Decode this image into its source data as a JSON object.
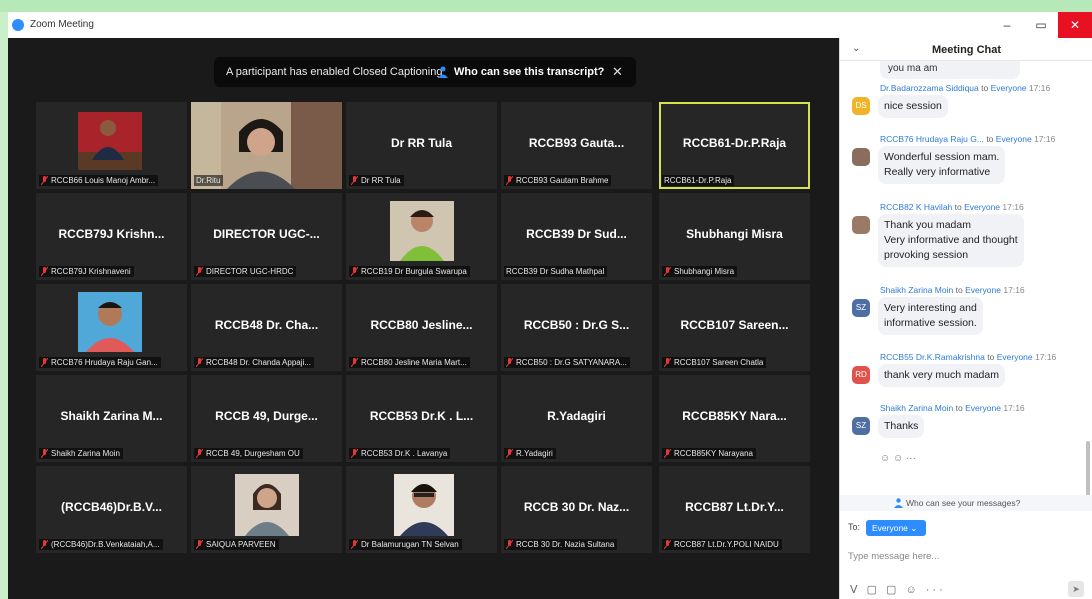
{
  "window": {
    "title": "Zoom Meeting",
    "minimize": "–",
    "restore": "▭",
    "close": "✕"
  },
  "banner": {
    "text": "A participant has enabled Closed Captioning",
    "link": "Who can see this transcript?",
    "close": "✕"
  },
  "tiles": [
    {
      "name": "",
      "label": "RCCB66 Louis Manoj Ambr..."
    },
    {
      "name": "",
      "label": "Dr.Ritu"
    },
    {
      "name": "Dr RR Tula",
      "label": "Dr RR Tula"
    },
    {
      "name": "RCCB93  Gauta...",
      "label": "RCCB93  Gautam Brahme"
    },
    {
      "name": "RCCB61-Dr.P.Raja",
      "label": "RCCB61-Dr.P.Raja"
    },
    {
      "name": "RCCB79J  Krishn...",
      "label": "RCCB79J Krishnaveni"
    },
    {
      "name": "DIRECTOR  UGC-...",
      "label": "DIRECTOR UGC-HRDC"
    },
    {
      "name": "",
      "label": "RCCB19 Dr Burgula Swarupa"
    },
    {
      "name": "RCCB39  Dr  Sud...",
      "label": "RCCB39 Dr Sudha Mathpal"
    },
    {
      "name": "Shubhangi Misra",
      "label": "Shubhangi Misra"
    },
    {
      "name": "",
      "label": "RCCB76 Hrudaya Raju Gan..."
    },
    {
      "name": "RCCB48  Dr. Cha...",
      "label": "RCCB48 Dr. Chanda Appaji..."
    },
    {
      "name": "RCCB80  Jesline...",
      "label": "RCCB80 Jesline Maria Mart..."
    },
    {
      "name": "RCCB50 : Dr.G S...",
      "label": "RCCB50 : Dr.G SATYANARA..."
    },
    {
      "name": "RCCB107  Sareen...",
      "label": "RCCB107 Sareen Chatla"
    },
    {
      "name": "Shaikh  Zarina  M...",
      "label": "Shaikh Zarina Moin"
    },
    {
      "name": "RCCB 49,  Durge...",
      "label": "RCCB 49, Durgesham OU"
    },
    {
      "name": "RCCB53  Dr.K . L...",
      "label": "RCCB53 Dr.K . Lavanya"
    },
    {
      "name": "R.Yadagiri",
      "label": "R.Yadagiri"
    },
    {
      "name": "RCCB85KY  Nara...",
      "label": "RCCB85KY Narayana"
    },
    {
      "name": "(RCCB46)Dr.B.V...",
      "label": "(RCCB46)Dr.B.Venkataiah,A..."
    },
    {
      "name": "",
      "label": "SAIQUA PARVEEN"
    },
    {
      "name": "",
      "label": "Dr Balamurugan TN Selvan"
    },
    {
      "name": "RCCB 30  Dr.  Naz...",
      "label": "RCCB 30 Dr. Nazia Sultana"
    },
    {
      "name": "RCCB87  Lt.Dr.Y...",
      "label": "RCCB87 Lt.Dr.Y.POLI NAIDU"
    }
  ],
  "chat": {
    "title": "Meeting Chat",
    "collapse": "⌄",
    "top_fragment": "you ma am",
    "messages": [
      {
        "avatar": "DS",
        "avatar_color": "#f0b429",
        "sender": "Dr.Badarozzama Siddiqua",
        "to": "to",
        "recipient": "Everyone",
        "time": "17:16",
        "lines": [
          "nice session"
        ]
      },
      {
        "avatar": "",
        "avatar_color": "#8a6d5c",
        "sender": "RCCB76 Hrudaya Raju G...",
        "to": "to",
        "recipient": "Everyone",
        "time": "17:16",
        "lines": [
          "Wonderful session mam.",
          "Really very informative"
        ]
      },
      {
        "avatar": "",
        "avatar_color": "#9a7a66",
        "sender": "RCCB82 K Havilah",
        "to": "to",
        "recipient": "Everyone",
        "time": "17:16",
        "lines": [
          "Thank you madam",
          "Very informative and thought",
          "provoking session"
        ]
      },
      {
        "avatar": "SZ",
        "avatar_color": "#4f6fa3",
        "sender": "Shaikh Zarina Moin",
        "to": "to",
        "recipient": "Everyone",
        "time": "17:16",
        "lines": [
          "Very interesting and",
          "informative  session."
        ]
      },
      {
        "avatar": "RD",
        "avatar_color": "#e0524b",
        "sender": "RCCB55 Dr.K.Ramakrishna",
        "to": "to",
        "recipient": "Everyone",
        "time": "17:16",
        "lines": [
          "thank very much madam"
        ]
      },
      {
        "avatar": "SZ",
        "avatar_color": "#4f6fa3",
        "sender": "Shaikh Zarina Moin",
        "to": "to",
        "recipient": "Everyone",
        "time": "17:16",
        "lines": [
          "Thanks"
        ]
      }
    ],
    "reactions": "☺ ☺ ···",
    "who_can_see": "Who can see your messages?",
    "to_label": "To:",
    "recipient_select": "Everyone ⌄",
    "input_placeholder": "Type message here...",
    "toolbar": "ᐯ ▢ ▢ ☺ ···",
    "send": "➤"
  }
}
